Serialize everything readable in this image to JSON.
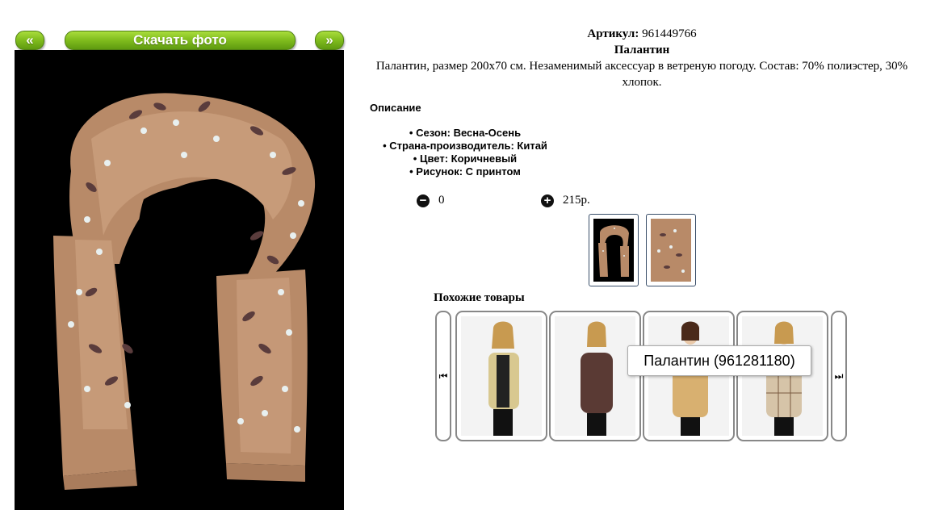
{
  "gallery": {
    "prev_label": "«",
    "download_label": "Скачать фото",
    "next_label": "»"
  },
  "product": {
    "article_label": "Артикул:",
    "article_value": "961449766",
    "name": "Палантин",
    "description": "Палантин, размер 200х70 см. Незаменимый аксессуар в ветреную погоду. Состав: 70% полиэстер, 30% хлопок."
  },
  "details": {
    "title": "Описание",
    "items": [
      "Сезон: Весна-Осень",
      "Страна-производитель: Китай",
      "Цвет: Коричневый",
      "Рисунок: С принтом"
    ]
  },
  "cart": {
    "quantity": "0",
    "price": "215р."
  },
  "similar": {
    "title": "Похожие товары",
    "tooltip": "Палантин (961281180)"
  },
  "colors": {
    "accent_green": "#7fbb1d",
    "scarf": "#b88a68",
    "dark_print": "#5a3c3c"
  }
}
